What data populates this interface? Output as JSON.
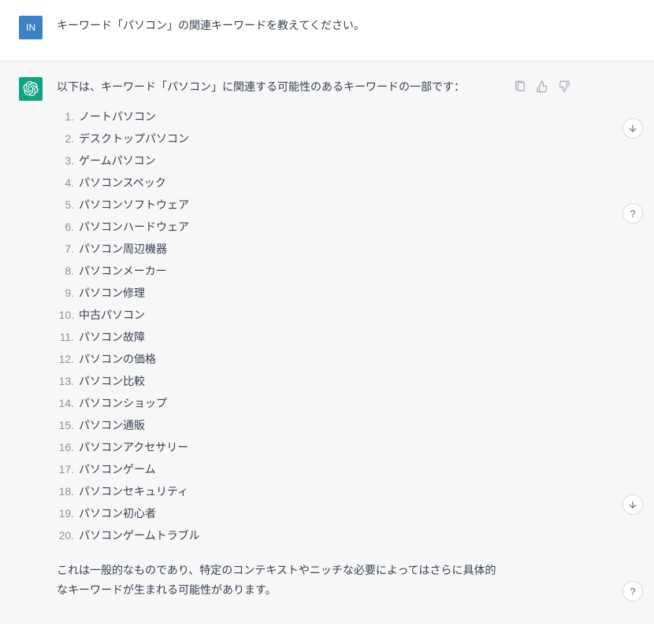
{
  "user": {
    "avatar_label": "IN",
    "message": "キーワード「パソコン」の関連キーワードを教えてください。"
  },
  "assistant": {
    "intro": "以下は、キーワード「パソコン」に関連する可能性のあるキーワードの一部です：",
    "keywords": [
      "ノートパソコン",
      "デスクトップパソコン",
      "ゲームパソコン",
      "パソコンスペック",
      "パソコンソフトウェア",
      "パソコンハードウェア",
      "パソコン周辺機器",
      "パソコンメーカー",
      "パソコン修理",
      "中古パソコン",
      "パソコン故障",
      "パソコンの価格",
      "パソコン比較",
      "パソコンショップ",
      "パソコン通販",
      "パソコンアクセサリー",
      "パソコンゲーム",
      "パソコンセキュリティ",
      "パソコン初心者",
      "パソコンゲームトラブル"
    ],
    "outro": "これは一般的なものであり、特定のコンテキストやニッチな必要によってはさらに具体的なキーワードが生まれる可能性があります。"
  },
  "help_label": "?"
}
